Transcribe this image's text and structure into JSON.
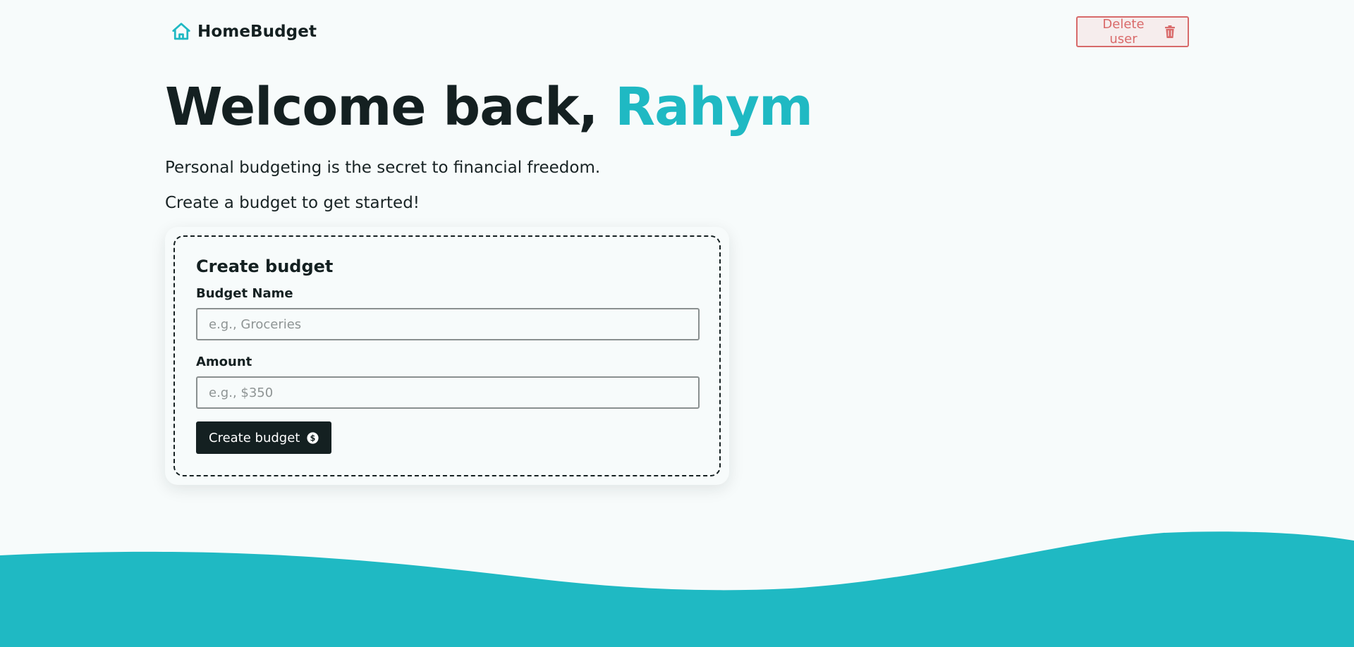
{
  "nav": {
    "brand": "HomeBudget",
    "brand_icon": "home-icon",
    "delete_label": "Delete user",
    "delete_icon": "trash-icon"
  },
  "hero": {
    "greeting": "Welcome back, ",
    "username": "Rahym",
    "tagline": "Personal budgeting is the secret to financial freedom.",
    "prompt": "Create a budget to get started!"
  },
  "form": {
    "title": "Create budget",
    "name_label": "Budget Name",
    "name_placeholder": "e.g., Groceries",
    "amount_label": "Amount",
    "amount_placeholder": "e.g., $350",
    "submit_label": "Create budget",
    "submit_icon": "dollar-circle-icon"
  },
  "colors": {
    "accent": "#1fb9c3",
    "dark": "#142021",
    "danger": "#d96a6a",
    "background": "#f7fbfb"
  }
}
